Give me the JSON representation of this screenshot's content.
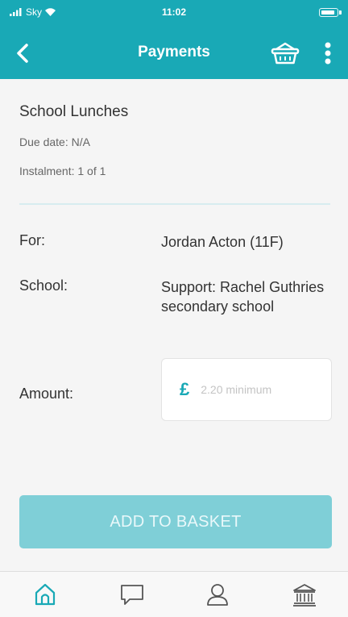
{
  "status_bar": {
    "carrier": "Sky",
    "time": "11:02"
  },
  "header": {
    "title": "Payments"
  },
  "payment": {
    "name": "School Lunches",
    "due_date": "Due date: N/A",
    "instalment": "Instalment: 1 of 1"
  },
  "details": {
    "for_label": "For:",
    "for_value": "Jordan Acton (11F)",
    "school_label": "School:",
    "school_value": "Support: Rachel Guthries secondary school",
    "amount_label": "Amount:",
    "currency": "£",
    "amount_placeholder": "2.20 minimum",
    "amount_value": ""
  },
  "actions": {
    "add_to_basket": "ADD TO BASKET"
  },
  "tabs": [
    {
      "icon": "home-icon",
      "active": true
    },
    {
      "icon": "chat-icon",
      "active": false
    },
    {
      "icon": "user-icon",
      "active": false
    },
    {
      "icon": "bank-icon",
      "active": false
    }
  ],
  "colors": {
    "brand": "#19a9b6",
    "button_disabled": "#7fcfd7"
  }
}
